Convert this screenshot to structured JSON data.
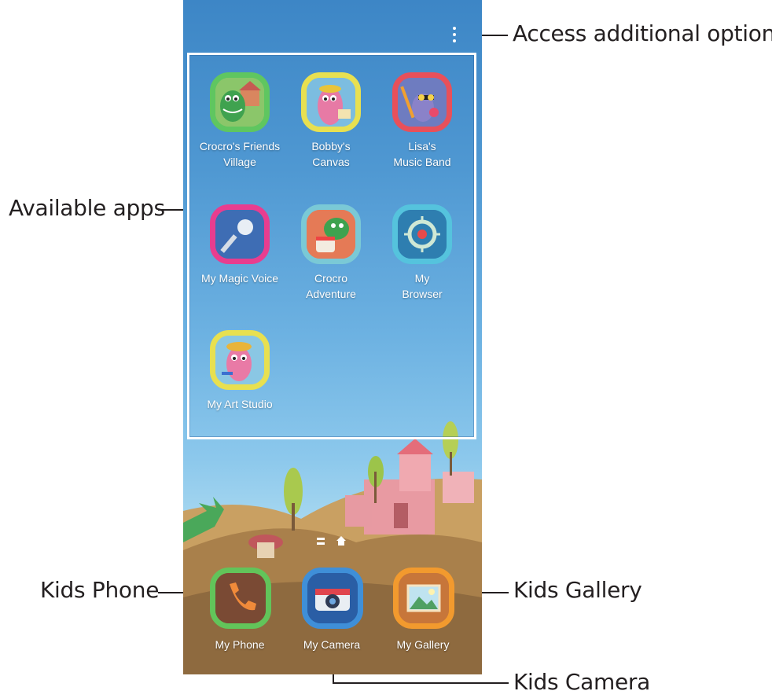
{
  "callouts": {
    "options": "Access additional options.",
    "available_apps": "Available apps",
    "kids_phone": "Kids Phone",
    "kids_gallery": "Kids Gallery",
    "kids_camera": "Kids Camera"
  },
  "apps": [
    {
      "label": "Crocro's Friends\nVillage",
      "icon": "crocro-friends-village-icon",
      "border": "#5fc660"
    },
    {
      "label": "Bobby's\nCanvas",
      "icon": "bobbys-canvas-icon",
      "border": "#e8e050"
    },
    {
      "label": "Lisa's\nMusic Band",
      "icon": "lisas-music-band-icon",
      "border": "#e8505a"
    },
    {
      "label": "My Magic Voice",
      "icon": "microphone-icon",
      "border": "#e83d8f"
    },
    {
      "label": "Crocro\nAdventure",
      "icon": "crocro-adventure-icon",
      "border": "#7ac9d6"
    },
    {
      "label": "My\nBrowser",
      "icon": "browser-compass-icon",
      "border": "#55c3dd"
    },
    {
      "label": "My Art Studio",
      "icon": "my-art-studio-icon",
      "border": "#e8e050"
    }
  ],
  "dock": [
    {
      "label": "My Phone",
      "icon": "phone-handset-icon",
      "border": "#62c45a"
    },
    {
      "label": "My Camera",
      "icon": "camera-icon",
      "border": "#3f8fd8"
    },
    {
      "label": "My Gallery",
      "icon": "gallery-picture-icon",
      "border": "#f29a2e"
    }
  ]
}
